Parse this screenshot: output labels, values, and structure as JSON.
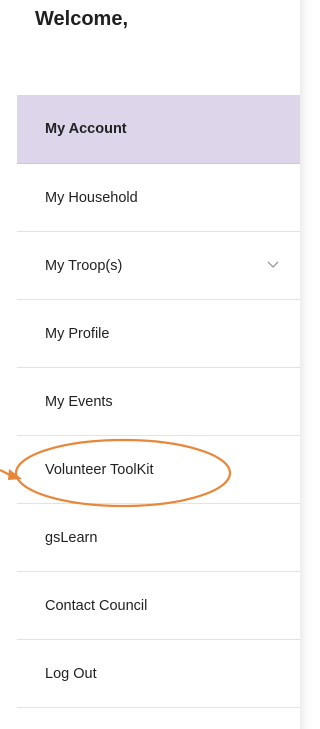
{
  "header": {
    "welcome": "Welcome,"
  },
  "menu": {
    "items": [
      {
        "label": "My Account",
        "active": true
      },
      {
        "label": "My Household"
      },
      {
        "label": "My Troop(s)",
        "has_dropdown": true
      },
      {
        "label": "My Profile"
      },
      {
        "label": "My Events"
      },
      {
        "label": "Volunteer ToolKit",
        "highlighted": true
      },
      {
        "label": "gsLearn"
      },
      {
        "label": "Contact Council"
      },
      {
        "label": "Log Out"
      }
    ]
  },
  "colors": {
    "active_bg": "#ddd5ea",
    "annotation": "#e8873a"
  },
  "icons": {
    "dropdown": "chevron-down-icon"
  }
}
